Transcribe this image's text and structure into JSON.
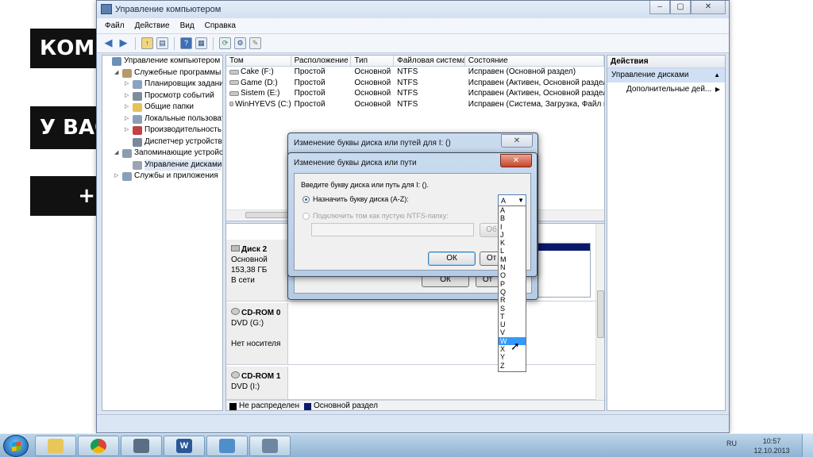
{
  "overlays": [
    "КОМП",
    "У ВАС",
    "+"
  ],
  "window": {
    "title": "Управление компьютером",
    "buttons": [
      "–",
      "▢",
      "✕"
    ]
  },
  "menu": [
    "Файл",
    "Действие",
    "Вид",
    "Справка"
  ],
  "tree": [
    {
      "label": "Управление компьютером (л",
      "indent": 0,
      "exp": "",
      "icon": "computer-icon",
      "color": "#6d8fb8"
    },
    {
      "label": "Служебные программы",
      "indent": 1,
      "exp": "◢",
      "icon": "tools-icon",
      "color": "#b59a6c"
    },
    {
      "label": "Планировщик заданий",
      "indent": 2,
      "exp": "▷",
      "icon": "clock-icon",
      "color": "#8aa3c2"
    },
    {
      "label": "Просмотр событий",
      "indent": 2,
      "exp": "▷",
      "icon": "event-viewer-icon",
      "color": "#7d8d9e"
    },
    {
      "label": "Общие папки",
      "indent": 2,
      "exp": "▷",
      "icon": "shared-folder-icon",
      "color": "#e5c15a"
    },
    {
      "label": "Локальные пользовате",
      "indent": 2,
      "exp": "▷",
      "icon": "users-icon",
      "color": "#8c9fb6"
    },
    {
      "label": "Производительность",
      "indent": 2,
      "exp": "▷",
      "icon": "performance-icon",
      "color": "#c24141"
    },
    {
      "label": "Диспетчер устройств",
      "indent": 2,
      "exp": "",
      "icon": "device-manager-icon",
      "color": "#7a8a9a"
    },
    {
      "label": "Запоминающие устройст",
      "indent": 1,
      "exp": "◢",
      "icon": "storage-icon",
      "color": "#8a9cb0"
    },
    {
      "label": "Управление дисками",
      "indent": 2,
      "exp": "",
      "icon": "disk-management-icon",
      "color": "#9aa5b3",
      "selected": true
    },
    {
      "label": "Службы и приложения",
      "indent": 1,
      "exp": "▷",
      "icon": "services-icon",
      "color": "#8aa0b8"
    }
  ],
  "volumes": {
    "columns": [
      "Том",
      "Расположение",
      "Тип",
      "Файловая система",
      "Состояние"
    ],
    "rows": [
      [
        "Cake (F:)",
        "Простой",
        "Основной",
        "NTFS",
        "Исправен (Основной раздел)"
      ],
      [
        "Game (D:)",
        "Простой",
        "Основной",
        "NTFS",
        "Исправен (Активен, Основной раздел)"
      ],
      [
        "Sistem (E:)",
        "Простой",
        "Основной",
        "NTFS",
        "Исправен (Активен, Основной раздел)"
      ],
      [
        "WinHYEVS (C:)",
        "Простой",
        "Основной",
        "NTFS",
        "Исправен (Система, Загрузка, Файл по"
      ]
    ]
  },
  "disks": {
    "disk2": {
      "name": "Диск 2",
      "type": "Основной",
      "size": "153,38 ГБ",
      "status": "В сети"
    },
    "cdrom0": {
      "name": "CD-ROM 0",
      "drive": "DVD (G:)",
      "status": "Нет носителя"
    },
    "cdrom1": {
      "name": "CD-ROM 1",
      "drive": "DVD (I:)"
    }
  },
  "legend": {
    "unallocated": "Не распределен",
    "primary": "Основной раздел",
    "unallocated_color": "#000000",
    "primary_color": "#0a1a6b"
  },
  "actions": {
    "header": "Действия",
    "section": "Управление дисками",
    "more": "Дополнительные дей..."
  },
  "dialog_back": {
    "title": "Изменение буквы диска или путей для I: ()",
    "ok": "ОК",
    "cancel": "От"
  },
  "dialog_front": {
    "title": "Изменение буквы диска или пути",
    "prompt": "Введите букву диска или путь для I: ().",
    "assign_label": "Назначить букву диска (A-Z):",
    "mount_label": "Подключить том как пустую NTFS-папку:",
    "browse": "Об",
    "ok": "ОК",
    "cancel": "От",
    "selected_letter": "A"
  },
  "letters": [
    "A",
    "B",
    "I",
    "J",
    "K",
    "L",
    "M",
    "N",
    "O",
    "P",
    "Q",
    "R",
    "S",
    "T",
    "U",
    "V",
    "W",
    "X",
    "Y",
    "Z"
  ],
  "highlighted_letter": "W",
  "taskbar": {
    "lang": "RU",
    "time": "10:57",
    "date": "12.10.2013"
  }
}
